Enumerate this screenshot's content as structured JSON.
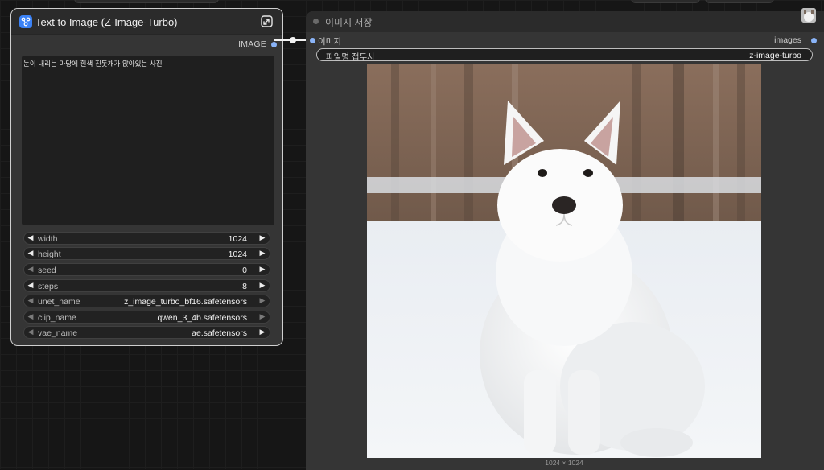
{
  "text_to_image_node": {
    "title": "Text to Image (Z-Image-Turbo)",
    "output_label": "IMAGE",
    "prompt": "눈이 내리는 마당에 흰색 진돗개가 앉아있는 사진",
    "widgets": [
      {
        "name": "width",
        "value": "1024"
      },
      {
        "name": "height",
        "value": "1024"
      },
      {
        "name": "seed",
        "value": "0"
      },
      {
        "name": "steps",
        "value": "8"
      },
      {
        "name": "unet_name",
        "value": "z_image_turbo_bf16.safetensors"
      },
      {
        "name": "clip_name",
        "value": "qwen_3_4b.safetensors"
      },
      {
        "name": "vae_name",
        "value": "ae.safetensors"
      }
    ]
  },
  "save_image_node": {
    "title": "이미지 저장",
    "input_label": "이미지",
    "output_label": "images",
    "filename_prefix_label": "파일명 접두사",
    "filename_prefix_value": "z-image-turbo",
    "image_dimensions": "1024 × 1024"
  },
  "colors": {
    "slot_blue": "#8ab4f8",
    "node_icon_blue": "#3b82f6"
  }
}
